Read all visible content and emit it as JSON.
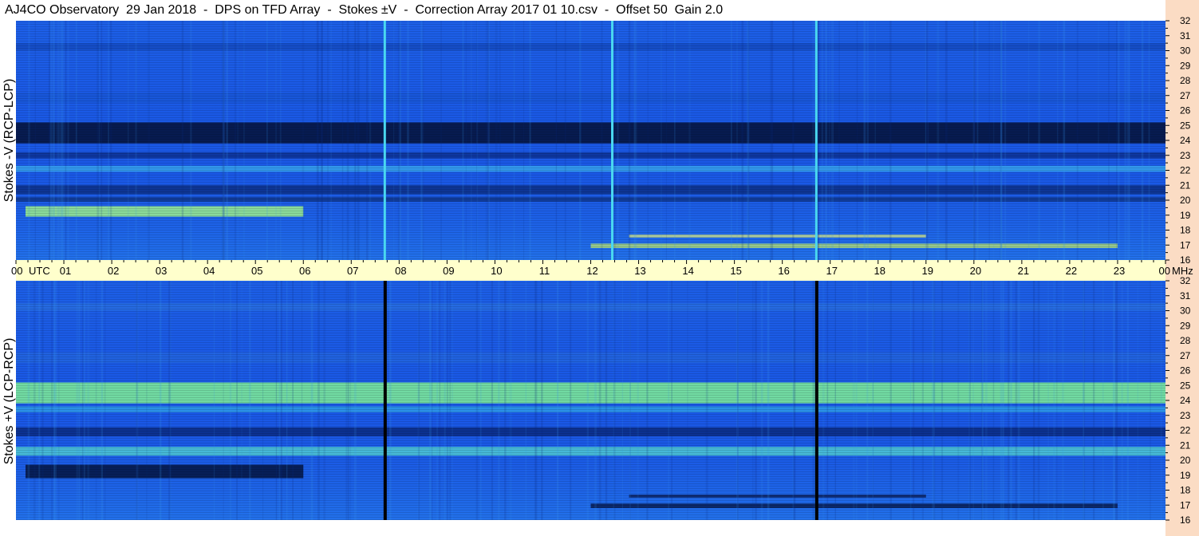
{
  "title": "AJ4CO Observatory  29 Jan 2018  -  DPS on TFD Array  -  Stokes ±V  -  Correction Array 2017 01 10.csv  -  Offset 50  Gain 2.0",
  "colors": {
    "panel_bg": "#1a58e6",
    "right_strip": "#fbdcc4",
    "time_strip": "#ffffcc",
    "dark_band": "#04103c",
    "bright_band": "#33c8e6",
    "yellow_band": "#c8f064",
    "cyan_line": "#4ad8f0",
    "black_line": "#000000"
  },
  "chart_data": [
    {
      "type": "heatmap",
      "name": "Stokes -V (RCP-LCP)",
      "ylabel": "Stokes -V (RCP-LCP)",
      "xlabel": "UTC",
      "yunit": "MHz",
      "ylim": [
        16,
        32
      ],
      "yticks": [
        16,
        17,
        18,
        19,
        20,
        21,
        22,
        23,
        24,
        25,
        26,
        27,
        28,
        29,
        30,
        31,
        32
      ],
      "xlim": [
        0,
        24
      ],
      "bands": [
        {
          "f0": 23.8,
          "f1": 25.2,
          "color": "#061848",
          "opacity": 0.95
        },
        {
          "f0": 22.8,
          "f1": 23.2,
          "color": "#0a2a80",
          "opacity": 0.7
        },
        {
          "f0": 21.9,
          "f1": 22.3,
          "color": "#38a8ee",
          "opacity": 0.8
        },
        {
          "f0": 20.4,
          "f1": 21.0,
          "color": "#0b2a78",
          "opacity": 0.75
        },
        {
          "f0": 19.9,
          "f1": 20.2,
          "color": "#0a2464",
          "opacity": 0.6
        },
        {
          "f0": 30.0,
          "f1": 30.5,
          "color": "#0d3da8",
          "opacity": 0.5
        },
        {
          "f0": 26.5,
          "f1": 27.2,
          "color": "#1450c8",
          "opacity": 0.4
        }
      ],
      "features": [
        {
          "t0": 0.2,
          "t1": 6.0,
          "f0": 18.9,
          "f1": 19.6,
          "color": "#9ef08c",
          "opacity": 0.85
        },
        {
          "t0": 12.0,
          "t1": 23.0,
          "f0": 16.8,
          "f1": 17.1,
          "color": "#c8f064",
          "opacity": 0.7
        },
        {
          "t0": 12.8,
          "t1": 19.0,
          "f0": 17.5,
          "f1": 17.7,
          "color": "#e0f080",
          "opacity": 0.7
        }
      ],
      "vlines": [
        {
          "t": 7.7,
          "color": "#4ad8f0"
        },
        {
          "t": 16.71,
          "color": "#4ad8f0"
        },
        {
          "t": 12.45,
          "color": "#4ad8f0"
        }
      ]
    },
    {
      "type": "heatmap",
      "name": "Stokes +V (LCP-RCP)",
      "ylabel": "Stokes +V (LCP-RCP)",
      "xlabel": "UTC",
      "yunit": "MHz",
      "ylim": [
        16,
        32
      ],
      "yticks": [
        16,
        17,
        18,
        19,
        20,
        21,
        22,
        23,
        24,
        25,
        26,
        27,
        28,
        29,
        30,
        31,
        32
      ],
      "xlim": [
        0,
        24
      ],
      "bands": [
        {
          "f0": 23.8,
          "f1": 25.2,
          "color": "#7be89a",
          "opacity": 0.9
        },
        {
          "f0": 23.2,
          "f1": 23.6,
          "color": "#35b5e8",
          "opacity": 0.6
        },
        {
          "f0": 21.6,
          "f1": 22.2,
          "color": "#0a2a80",
          "opacity": 0.85
        },
        {
          "f0": 20.3,
          "f1": 20.9,
          "color": "#56d8d0",
          "opacity": 0.75
        },
        {
          "f0": 30.0,
          "f1": 30.5,
          "color": "#2e78dc",
          "opacity": 0.5
        },
        {
          "f0": 26.5,
          "f1": 27.2,
          "color": "#2a6ed6",
          "opacity": 0.4
        }
      ],
      "features": [
        {
          "t0": 0.2,
          "t1": 6.0,
          "f0": 18.8,
          "f1": 19.7,
          "color": "#061848",
          "opacity": 0.9
        },
        {
          "t0": 12.0,
          "t1": 23.0,
          "f0": 16.8,
          "f1": 17.1,
          "color": "#061848",
          "opacity": 0.8
        },
        {
          "t0": 12.8,
          "t1": 19.0,
          "f0": 17.5,
          "f1": 17.7,
          "color": "#0a1e58",
          "opacity": 0.8
        }
      ],
      "vlines": [
        {
          "t": 7.7,
          "color": "#000000"
        },
        {
          "t": 16.71,
          "color": "#000000"
        }
      ]
    }
  ],
  "time_axis": {
    "labels": [
      "00",
      "01",
      "02",
      "03",
      "04",
      "05",
      "06",
      "07",
      "08",
      "09",
      "10",
      "11",
      "12",
      "13",
      "14",
      "15",
      "16",
      "17",
      "18",
      "19",
      "20",
      "21",
      "22",
      "23",
      "00"
    ],
    "utc_label": "UTC",
    "freq_unit_label": "MHz"
  }
}
